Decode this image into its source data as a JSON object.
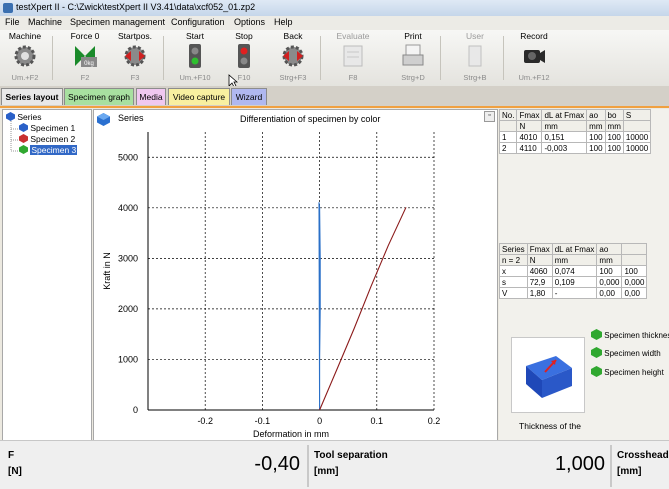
{
  "window": {
    "title": "testXpert II  -  C:\\Zwick\\testXpert II V3.41\\data\\xcf052_01.zp2"
  },
  "menu": [
    "File",
    "Machine",
    "Specimen management",
    "Configuration",
    "Options",
    "Help"
  ],
  "toolbar": [
    {
      "label": "Machine",
      "key": "Um.+F2",
      "icon": "machine-gear-icon",
      "enabled": true
    },
    {
      "label": "Force 0",
      "key": "F2",
      "icon": "force-zero-icon",
      "enabled": true
    },
    {
      "label": "Startpos.",
      "key": "F3",
      "icon": "start-position-icon",
      "enabled": true
    },
    {
      "label": "Start",
      "key": "Um.+F10",
      "icon": "start-traffic-light-icon",
      "enabled": true
    },
    {
      "label": "Stop",
      "key": "F10",
      "icon": "stop-traffic-light-icon",
      "enabled": true
    },
    {
      "label": "Back",
      "key": "Strg+F3",
      "icon": "back-gear-icon",
      "enabled": true
    },
    {
      "label": "Evaluate",
      "key": "F8",
      "icon": "evaluate-icon",
      "enabled": false
    },
    {
      "label": "Print",
      "key": "Strg+D",
      "icon": "print-icon",
      "enabled": true
    },
    {
      "label": "User",
      "key": "Strg+B",
      "icon": "user-icon",
      "enabled": false
    },
    {
      "label": "Record",
      "key": "Um.+F12",
      "icon": "camera-icon",
      "enabled": true
    }
  ],
  "tabs": [
    {
      "label": "Series layout",
      "color": "#e8e8e8",
      "active": true
    },
    {
      "label": "Specimen graph",
      "color": "#a8e0a0"
    },
    {
      "label": "Media",
      "color": "#f0c8f0"
    },
    {
      "label": "Video capture",
      "color": "#f8f0a0"
    },
    {
      "label": "Wizard",
      "color": "#b0b8f0"
    }
  ],
  "tree": {
    "root": "Series",
    "items": [
      {
        "label": "Specimen 1",
        "icon": "blue-cube-icon",
        "color": "#2a60c8"
      },
      {
        "label": "Specimen 2",
        "icon": "red-cube-icon",
        "color": "#c83030"
      },
      {
        "label": "Specimen 3",
        "icon": "green-cube-icon",
        "color": "#30a830",
        "selected": true
      }
    ]
  },
  "graph": {
    "legend": "Series",
    "title": "Differentiation of specimen by color"
  },
  "chart_data": {
    "type": "line",
    "title": "Differentiation of specimen by color",
    "xlabel": "Deformation in mm",
    "ylabel": "Kraft in N",
    "xlim": [
      -0.3,
      0.2
    ],
    "ylim": [
      0,
      5500
    ],
    "xticks": [
      "-0.2",
      "-0.1",
      "0",
      "0.1",
      "0.2"
    ],
    "yticks": [
      "0",
      "1000",
      "2000",
      "3000",
      "4000",
      "5000"
    ],
    "grid": true,
    "series": [
      {
        "color": "#2a70c8",
        "x": [
          0.0,
          0.0,
          0.001,
          0.001,
          0.0,
          -0.001,
          0.0
        ],
        "y": [
          0,
          1000,
          2000,
          3000,
          4000,
          4110,
          0
        ]
      },
      {
        "color": "#8b1a1a",
        "x": [
          0.0,
          0.03,
          0.06,
          0.09,
          0.12,
          0.151
        ],
        "y": [
          0,
          800,
          1600,
          2450,
          3250,
          4010
        ]
      }
    ]
  },
  "results_table": {
    "headers": [
      [
        "No.",
        ""
      ],
      [
        "Fmax",
        "N"
      ],
      [
        "dL at Fmax",
        "mm"
      ],
      [
        "ao",
        "mm"
      ],
      [
        "bo",
        "mm"
      ],
      [
        "S",
        ""
      ]
    ],
    "rows": [
      [
        "1",
        "4010",
        "0,151",
        "100",
        "100",
        "10000"
      ],
      [
        "2",
        "4110",
        "-0,003",
        "100",
        "100",
        "10000"
      ]
    ]
  },
  "stats_table": {
    "headers": [
      [
        "Series",
        "n = 2"
      ],
      [
        "Fmax",
        "N"
      ],
      [
        "dL at Fmax",
        "mm"
      ],
      [
        "ao",
        "mm"
      ],
      [
        "",
        ""
      ]
    ],
    "rows": [
      [
        "x",
        "4060",
        "0,074",
        "100",
        "100"
      ],
      [
        "s",
        "72,9",
        "0,109",
        "0,000",
        "0,000"
      ],
      [
        "V",
        "1,80",
        "-",
        "0,00",
        "0,00"
      ]
    ]
  },
  "geometry_panel": {
    "caption": "Thickness of the",
    "options": [
      "Specimen thickness",
      "Specimen width",
      "Specimen height"
    ]
  },
  "statusbar": [
    {
      "label": "F",
      "unit": "[N]",
      "value": "-0,40"
    },
    {
      "label": "Tool separation",
      "unit": "[mm]",
      "value": "1,000"
    },
    {
      "label": "Crosshead",
      "unit": "[mm]",
      "value": ""
    }
  ]
}
